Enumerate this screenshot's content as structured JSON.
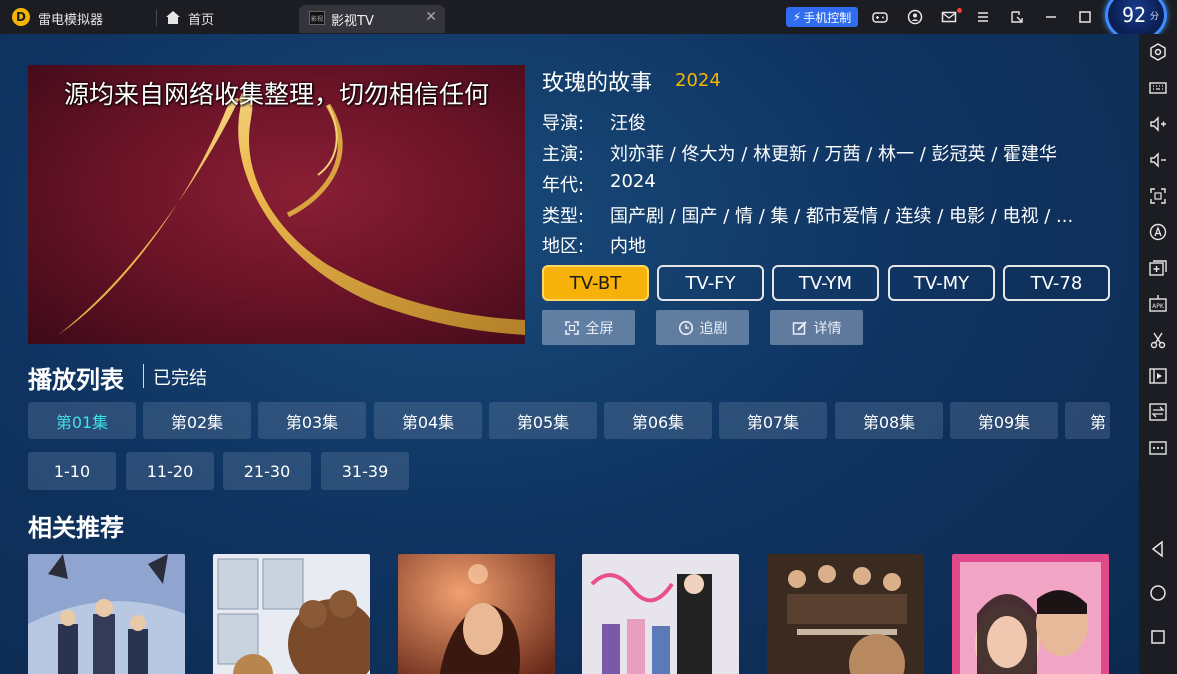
{
  "titlebar": {
    "app_name": "雷电模拟器",
    "home_label": "首页",
    "active_tab": "影视TV",
    "tab_icon_text": "影视",
    "phone_control": "手机控制",
    "perf_score": "92",
    "perf_unit": "分"
  },
  "show": {
    "title": "玫瑰的故事",
    "year": "2024",
    "caption": "源均来自网络收集整理，切勿相信任何",
    "meta": [
      {
        "label": "导演:",
        "value": "汪俊"
      },
      {
        "label": "主演:",
        "value": "刘亦菲 / 佟大为 / 林更新 / 万茜 / 林一 / 彭冠英 / 霍建华"
      },
      {
        "label": "年代:",
        "value": "2024"
      },
      {
        "label": "类型:",
        "value": "国产剧 / 国产 / 情 / 集 / 都市爱情 / 连续 / 电影 / 电视 / ..."
      },
      {
        "label": "地区:",
        "value": "内地"
      }
    ],
    "sources": [
      "TV-BT",
      "TV-FY",
      "TV-YM",
      "TV-MY",
      "TV-78"
    ],
    "actions": [
      "全屏",
      "追剧",
      "详情"
    ]
  },
  "playlist": {
    "title": "播放列表",
    "status": "已完结",
    "episodes": [
      "第01集",
      "第02集",
      "第03集",
      "第04集",
      "第05集",
      "第06集",
      "第07集",
      "第08集",
      "第09集",
      "第"
    ],
    "ranges": [
      "1-10",
      "11-20",
      "21-30",
      "31-39"
    ]
  },
  "related": {
    "title": "相关推荐"
  },
  "colors": {
    "accent": "#f5b400",
    "active_episode": "#3fe0e6",
    "background": "#0f2f54",
    "chrome": "#1c1d22"
  }
}
